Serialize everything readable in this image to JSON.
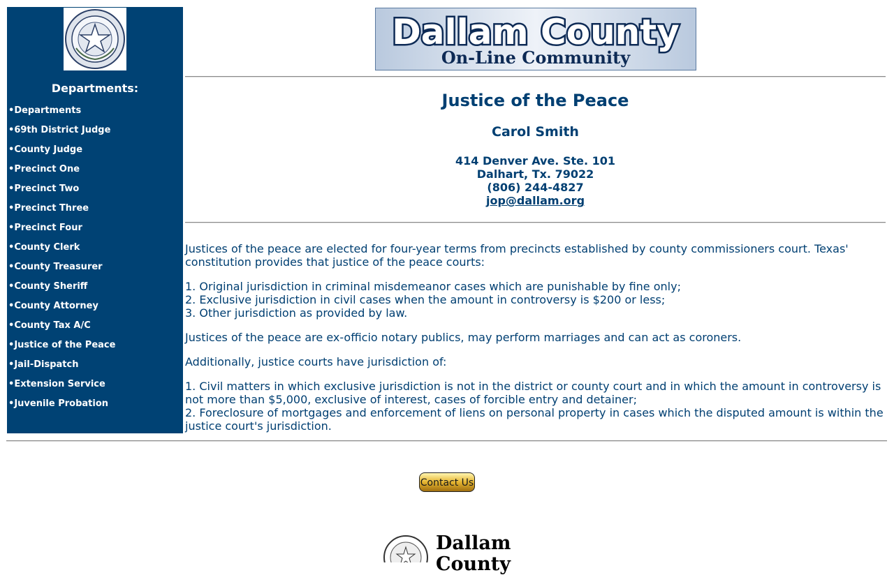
{
  "sidebar": {
    "heading": "Departments:",
    "items": [
      {
        "label": "Departments"
      },
      {
        "label": "69th District Judge"
      },
      {
        "label": "County Judge"
      },
      {
        "label": "Precinct One"
      },
      {
        "label": "Precinct Two"
      },
      {
        "label": "Precinct Three"
      },
      {
        "label": "Precinct Four"
      },
      {
        "label": "County Clerk"
      },
      {
        "label": "County Treasurer"
      },
      {
        "label": "County Sheriff"
      },
      {
        "label": "County Attorney"
      },
      {
        "label": "County Tax A/C"
      },
      {
        "label": "Justice of the Peace"
      },
      {
        "label": "Jail-Dispatch"
      },
      {
        "label": "Extension Service"
      },
      {
        "label": "Juvenile Probation"
      }
    ],
    "bullet": "•"
  },
  "banner": {
    "title": "Dallam County",
    "subtitle": "On-Line Community"
  },
  "page": {
    "title": "Justice of the Peace",
    "name": "Carol Smith",
    "address1": "414 Denver Ave. Ste. 101",
    "address2": "Dalhart, Tx. 79022",
    "phone": "(806) 244-4827",
    "email": "jop@dallam.org"
  },
  "content": {
    "p1": "Justices of the peace are elected for four-year terms from precincts established by county commissioners court. Texas' constitution provides that justice of the peace courts:",
    "list1": [
      "1. Original jurisdiction in criminal misdemeanor cases which are punishable by fine only;",
      "2. Exclusive jurisdiction in civil cases when the amount in controversy is $200 or less;",
      "3. Other jurisdiction as provided by law."
    ],
    "p2": "Justices of the peace are ex-officio notary publics, may perform marriages and can act as coroners.",
    "p3": "Additionally, justice courts have jurisdiction of:",
    "list2": [
      "1. Civil matters in which exclusive jurisdiction is not in the district or county court and in which the amount in controversy is not more than $5,000, exclusive of interest, cases of forcible entry and detainer;",
      "2. Foreclosure of mortgages and enforcement of liens on personal property in cases which the disputed amount is within the justice court's jurisdiction."
    ]
  },
  "contact": {
    "label": "Contact Us"
  },
  "footer": {
    "line1": "Dallam",
    "line2": "County"
  },
  "seal": {
    "ring_text": "THE STATE OF TEXAS"
  },
  "colors": {
    "sidebar": "#004274",
    "text": "#003f72",
    "banner_bg": "#c9d6e6"
  }
}
